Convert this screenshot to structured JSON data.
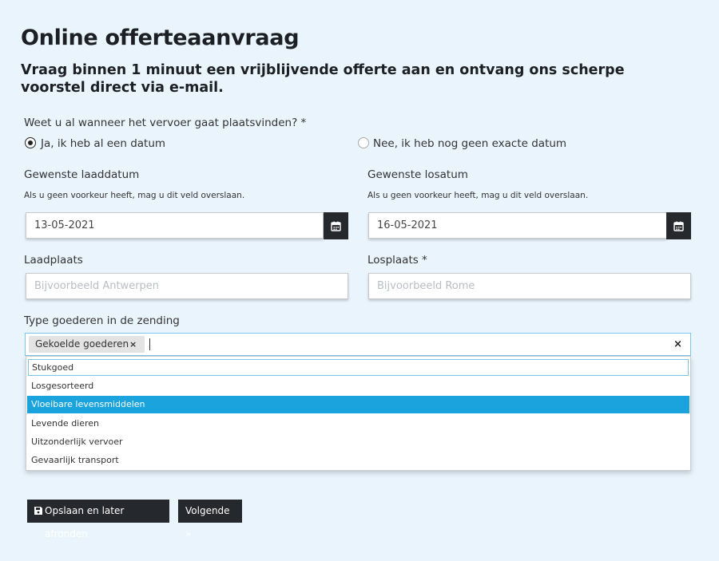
{
  "header": {
    "title": "Online offerteaanvraag",
    "subtitle": "Vraag binnen 1 minuut een vrijblijvende offerte aan en ontvang ons scherpe voorstel direct via e-mail."
  },
  "when": {
    "question": "Weet u al wanneer het vervoer gaat plaatsvinden? *",
    "option_yes": "Ja, ik heb al een datum",
    "option_no": "Nee, ik heb nog geen exacte datum",
    "selected": "yes"
  },
  "load_date": {
    "label": "Gewenste laaddatum",
    "help": "Als u geen voorkeur heeft, mag u dit veld overslaan.",
    "value": "13-05-2021",
    "icon": "calendar-icon"
  },
  "unload_date": {
    "label": "Gewenste losatum",
    "help": "Als u geen voorkeur heeft, mag u dit veld overslaan.",
    "value": "16-05-2021",
    "icon": "calendar-icon"
  },
  "load_place": {
    "label": "Laadplaats",
    "placeholder": "Bijvoorbeeld Antwerpen"
  },
  "unload_place": {
    "label": "Losplaats *",
    "placeholder": "Bijvoorbeeld Rome"
  },
  "goods": {
    "label": "Type goederen in de zending",
    "selected_tag": "Gekoelde goederen",
    "remove_glyph": "×",
    "clear_glyph": "×",
    "dropdown": {
      "search_value": "Stukgoed",
      "options": [
        "Losgesorteerd",
        "Vloeibare levensmiddelen",
        "Levende dieren",
        "Uitzonderlijk vervoer",
        "Gevaarlijk transport"
      ],
      "highlighted": "Vloeibare levensmiddelen"
    }
  },
  "actions": {
    "save_label": "Opslaan en later afronden",
    "save_icon": "floppy-disk-icon",
    "next_label": "Volgende »"
  },
  "colors": {
    "background": "#e9f4fd",
    "dark": "#25282c",
    "highlight": "#1aa3dd",
    "focus_border": "#7cc5e5"
  }
}
